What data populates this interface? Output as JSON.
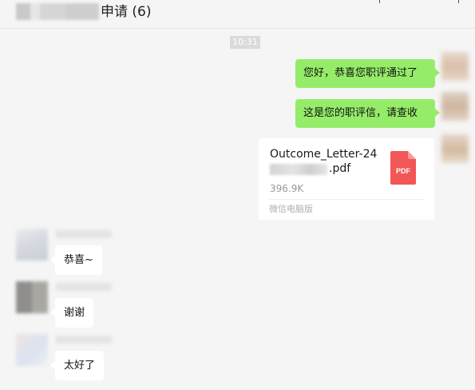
{
  "header": {
    "title": "申请 (6)"
  },
  "conversation": {
    "timestamp": "10:31",
    "outgoing": [
      {
        "text": "您好，恭喜您职评通过了"
      },
      {
        "text": "这是您的职评信，请查收"
      }
    ],
    "file": {
      "name_line1": "Outcome_Letter-24",
      "name_line2_suffix": ".pdf",
      "size": "396.9K",
      "source": "微信电脑版",
      "icon": "pdf-icon",
      "icon_label": "PDF",
      "icon_color": "#f25656"
    },
    "incoming": [
      {
        "text": "恭喜~"
      },
      {
        "text": "谢谢"
      },
      {
        "text": "太好了"
      }
    ]
  },
  "colors": {
    "outgoing_bubble": "#95ec69",
    "incoming_bubble": "#ffffff",
    "background": "#f5f5f5",
    "timestamp_bg": "#dadada"
  }
}
